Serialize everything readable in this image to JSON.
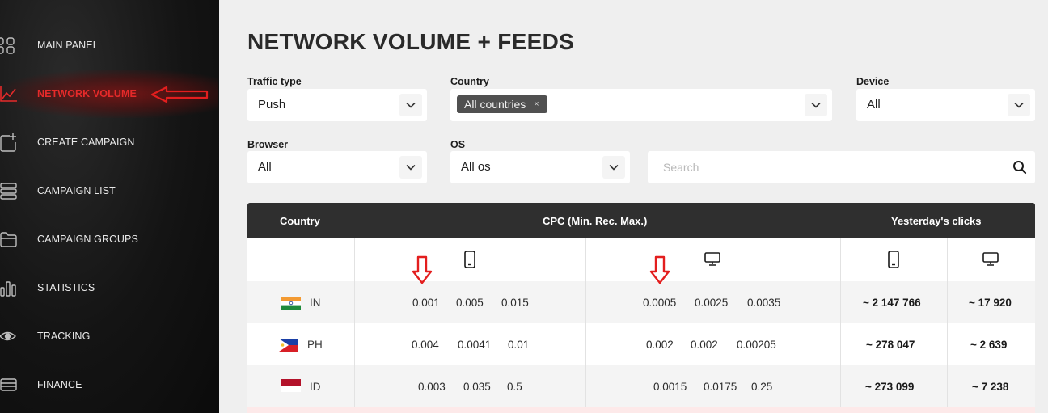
{
  "sidebar": {
    "items": [
      {
        "label": "MAIN PANEL",
        "icon": "grid-icon"
      },
      {
        "label": "NETWORK VOLUME",
        "icon": "chart-line-icon"
      },
      {
        "label": "CREATE CAMPAIGN",
        "icon": "add-square-icon"
      },
      {
        "label": "CAMPAIGN LIST",
        "icon": "list-icon"
      },
      {
        "label": "CAMPAIGN GROUPS",
        "icon": "folder-icon"
      },
      {
        "label": "STATISTICS",
        "icon": "bar-chart-icon"
      },
      {
        "label": "TRACKING",
        "icon": "eye-icon"
      },
      {
        "label": "FINANCE",
        "icon": "card-icon"
      }
    ],
    "active_color": "#e52a2a"
  },
  "page": {
    "title": "NETWORK VOLUME + FEEDS"
  },
  "filters": {
    "traffic_type": {
      "label": "Traffic type",
      "value": "Push"
    },
    "country": {
      "label": "Country",
      "tag": "All countries",
      "tag_remove": "×"
    },
    "device": {
      "label": "Device",
      "value": "All"
    },
    "browser": {
      "label": "Browser",
      "value": "All"
    },
    "os": {
      "label": "OS",
      "value": "All os"
    },
    "search": {
      "placeholder": "Search"
    }
  },
  "table": {
    "headers": {
      "country": "Country",
      "cpc": "CPC (Min. Rec. Max.)",
      "clicks": "Yesterday's clicks"
    },
    "rows": [
      {
        "cc": "IN",
        "mobile_cpc": [
          "0.001",
          "0.005",
          "0.015"
        ],
        "desktop_cpc": [
          "0.0005",
          "0.0025",
          "0.0035"
        ],
        "mobile_clicks": "~ 2 147 766",
        "desktop_clicks": "~ 17 920"
      },
      {
        "cc": "PH",
        "mobile_cpc": [
          "0.004",
          "0.0041",
          "0.01"
        ],
        "desktop_cpc": [
          "0.002",
          "0.002",
          "0.00205"
        ],
        "mobile_clicks": "~ 278 047",
        "desktop_clicks": "~ 2 639"
      },
      {
        "cc": "ID",
        "mobile_cpc": [
          "0.003",
          "0.035",
          "0.5"
        ],
        "desktop_cpc": [
          "0.0015",
          "0.0175",
          "0.25"
        ],
        "mobile_clicks": "~ 273 099",
        "desktop_clicks": "~ 7 238"
      }
    ]
  },
  "colors": {
    "header_bg": "#2f2f2f",
    "annotation_red": "#e31e1e"
  }
}
